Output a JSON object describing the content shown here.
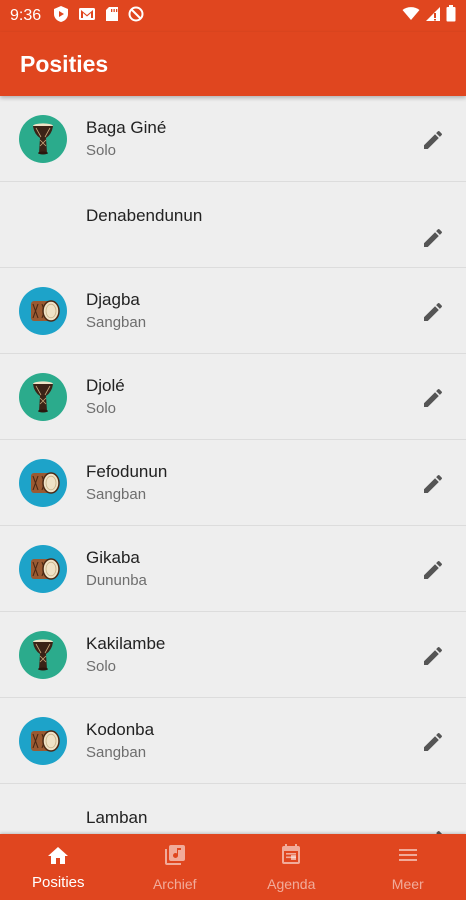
{
  "status_bar": {
    "time": "9:36"
  },
  "app_bar": {
    "title": "Posities"
  },
  "rows": [
    {
      "title": "Baga Giné",
      "subtitle": "Solo",
      "icon": "djembe-icon",
      "color": "#2bab8c"
    },
    {
      "title": "Denabendunun",
      "subtitle": "",
      "icon": "",
      "color": ""
    },
    {
      "title": "Djagba",
      "subtitle": "Sangban",
      "icon": "dunun-drum-icon",
      "color": "#1da3c9"
    },
    {
      "title": "Djolé",
      "subtitle": "Solo",
      "icon": "djembe-icon",
      "color": "#2bab8c"
    },
    {
      "title": "Fefodunun",
      "subtitle": "Sangban",
      "icon": "dunun-drum-icon",
      "color": "#1da3c9"
    },
    {
      "title": "Gikaba",
      "subtitle": "Dununba",
      "icon": "dunun-drum-icon",
      "color": "#1da3c9"
    },
    {
      "title": "Kakilambe",
      "subtitle": "Solo",
      "icon": "djembe-icon",
      "color": "#2bab8c"
    },
    {
      "title": "Kodonba",
      "subtitle": "Sangban",
      "icon": "dunun-drum-icon",
      "color": "#1da3c9"
    },
    {
      "title": "Lamban",
      "subtitle": "",
      "icon": "",
      "color": ""
    }
  ],
  "bottom_nav": [
    {
      "label": "Posities",
      "icon": "home-icon",
      "active": true
    },
    {
      "label": "Archief",
      "icon": "music-library-icon",
      "active": false
    },
    {
      "label": "Agenda",
      "icon": "calendar-icon",
      "active": false
    },
    {
      "label": "Meer",
      "icon": "menu-icon",
      "active": false
    }
  ],
  "colors": {
    "primary": "#e0461f",
    "background": "#eeeeee"
  }
}
